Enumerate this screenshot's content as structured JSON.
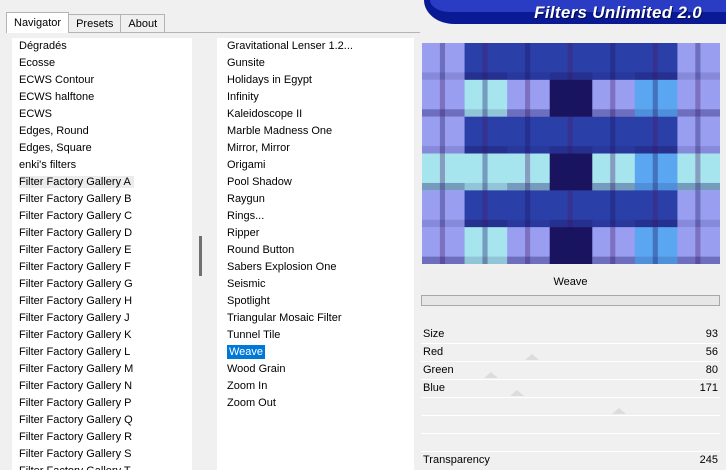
{
  "tabs": [
    "Navigator",
    "Presets",
    "About"
  ],
  "banner_title": "Filters Unlimited 2.0",
  "categories": [
    "Dégradés",
    "Ecosse",
    "ECWS Contour",
    "ECWS halftone",
    "ECWS",
    "Edges, Round",
    "Edges, Square",
    "enki's filters",
    "Filter Factory Gallery A",
    "Filter Factory Gallery B",
    "Filter Factory Gallery C",
    "Filter Factory Gallery D",
    "Filter Factory Gallery E",
    "Filter Factory Gallery F",
    "Filter Factory Gallery G",
    "Filter Factory Gallery H",
    "Filter Factory Gallery J",
    "Filter Factory Gallery K",
    "Filter Factory Gallery L",
    "Filter Factory Gallery M",
    "Filter Factory Gallery N",
    "Filter Factory Gallery P",
    "Filter Factory Gallery Q",
    "Filter Factory Gallery R",
    "Filter Factory Gallery S",
    "Filter Factory Gallery T"
  ],
  "selected_category": "Filter Factory Gallery A",
  "filters": [
    "Gravitational Lenser 1.2...",
    "Gunsite",
    "Holidays in Egypt",
    "Infinity",
    "Kaleidoscope II",
    "Marble Madness One",
    "Mirror, Mirror",
    "Origami",
    "Pool Shadow",
    "Raygun",
    "Rings...",
    "Ripper",
    "Round Button",
    "Sabers Explosion One",
    "Seismic",
    "Spotlight",
    "Triangular Mosaic Filter",
    "Tunnel Tile",
    "Weave",
    "Wood Grain",
    "Zoom In",
    "Zoom Out"
  ],
  "selected_filter": "Weave",
  "current_filter_name": "Weave",
  "parameters": [
    {
      "label": "Size",
      "value": 93
    },
    {
      "label": "Red",
      "value": 56
    },
    {
      "label": "Green",
      "value": 80
    },
    {
      "label": "Blue",
      "value": 171
    }
  ],
  "transparency": {
    "label": "Transparency",
    "value": 245
  },
  "colors": {
    "selection": "#0078d7",
    "banner": "#0a1a94",
    "preview_weave": [
      "#2b3fa8",
      "#9a9ef0",
      "#a6e4ee",
      "#5aa6f0",
      "#1a1460",
      "#4a1a6a"
    ]
  }
}
